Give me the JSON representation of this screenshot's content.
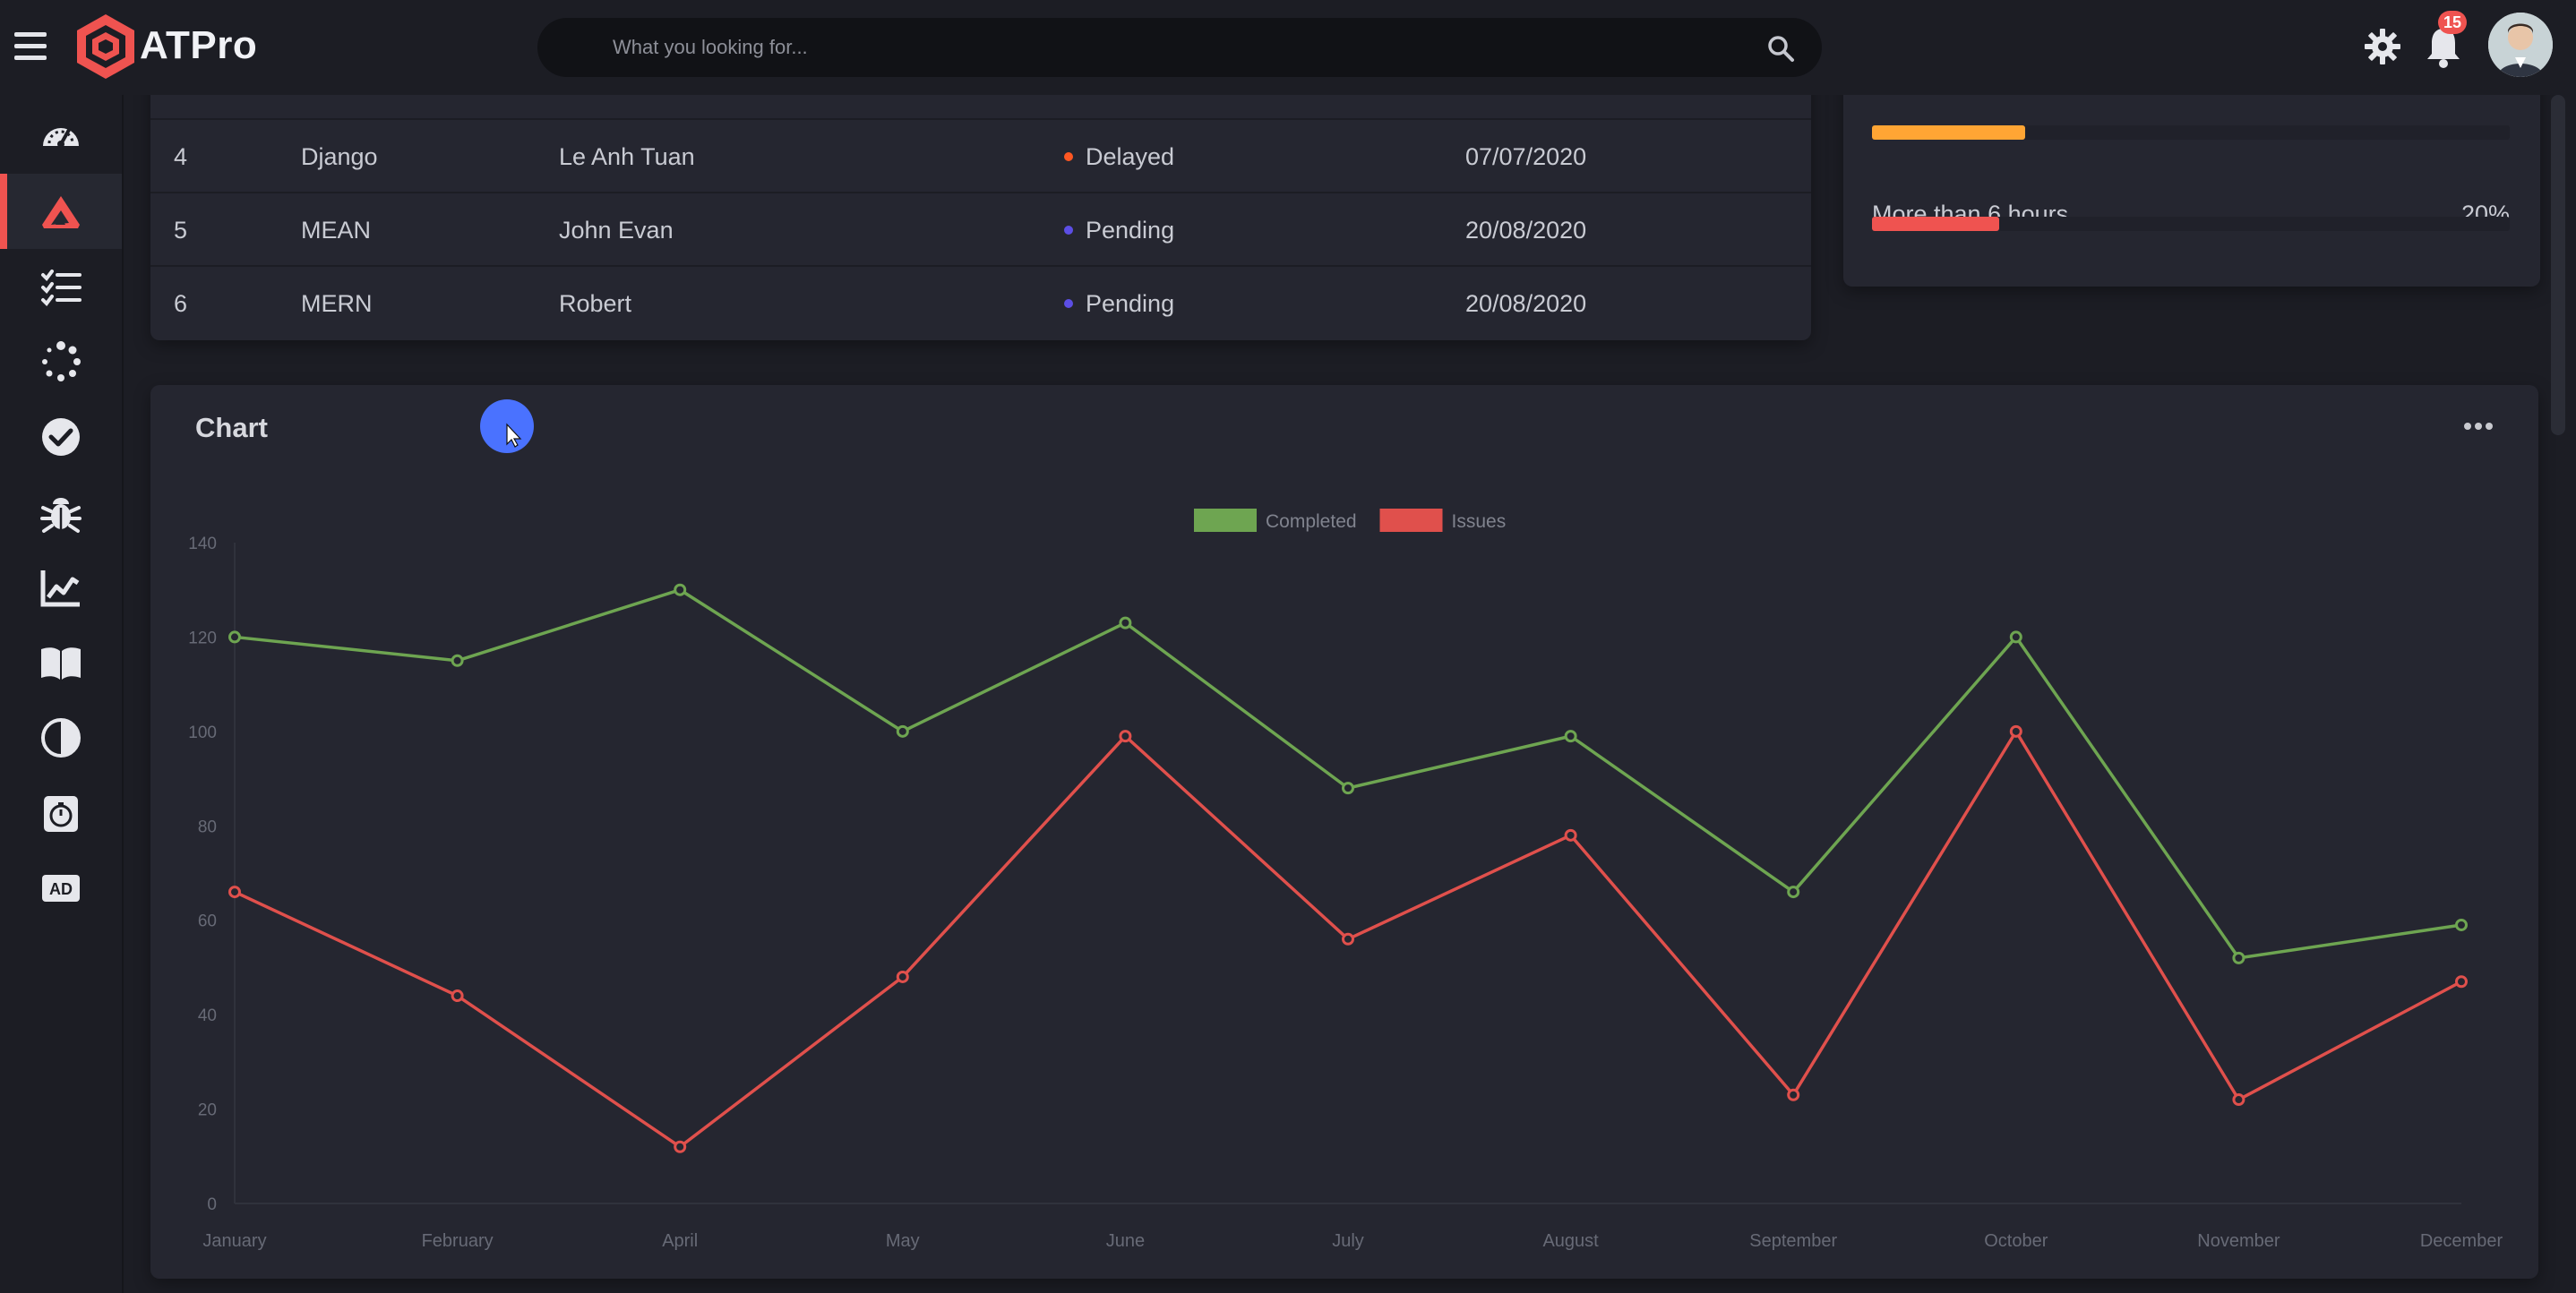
{
  "app": {
    "brand": "ATPro",
    "notifications": "15"
  },
  "search": {
    "placeholder": "What you looking for..."
  },
  "sidebar": {
    "items": [
      {
        "icon": "dashboard-gauge-icon"
      },
      {
        "icon": "projects-icon",
        "active": true
      },
      {
        "icon": "task-list-icon"
      },
      {
        "icon": "in-progress-icon"
      },
      {
        "icon": "completed-check-icon"
      },
      {
        "icon": "bug-icon"
      },
      {
        "icon": "statistics-chart-icon"
      },
      {
        "icon": "book-icon"
      },
      {
        "icon": "theme-contrast-icon"
      },
      {
        "icon": "stopwatch-icon"
      },
      {
        "icon": "ad-icon"
      }
    ]
  },
  "table": {
    "rows": [
      {
        "id": "4",
        "name": "Django",
        "lead": "Le Anh Tuan",
        "status": "Delayed",
        "status_color": "#ff5722",
        "date": "07/07/2020"
      },
      {
        "id": "5",
        "name": "MEAN",
        "lead": "John Evan",
        "status": "Pending",
        "status_color": "#5c4ee5",
        "date": "20/08/2020"
      },
      {
        "id": "6",
        "name": "MERN",
        "lead": "Robert",
        "status": "Pending",
        "status_color": "#5c4ee5",
        "date": "20/08/2020"
      }
    ]
  },
  "progress": {
    "top_bar": {
      "value": 0.24,
      "color": "#ffa534"
    },
    "label": "More than 6 hours",
    "percent": "20%",
    "bottom_bar": {
      "value": 0.2,
      "color": "#ef5350"
    }
  },
  "chart_card": {
    "title": "Chart"
  },
  "chart_data": {
    "type": "line",
    "categories": [
      "January",
      "February",
      "April",
      "May",
      "June",
      "July",
      "August",
      "September",
      "October",
      "November",
      "December"
    ],
    "series": [
      {
        "name": "Completed",
        "color": "#6ea551",
        "values": [
          120,
          115,
          130,
          100,
          123,
          88,
          99,
          66,
          120,
          52,
          59
        ]
      },
      {
        "name": "Issues",
        "color": "#e0504c",
        "values": [
          66,
          44,
          12,
          48,
          99,
          56,
          78,
          23,
          100,
          22,
          47
        ]
      }
    ],
    "yticks": [
      "0",
      "20",
      "40",
      "60",
      "80",
      "100",
      "120",
      "140"
    ],
    "ylim": [
      0,
      140
    ],
    "legend": "top-center",
    "grid": false
  }
}
